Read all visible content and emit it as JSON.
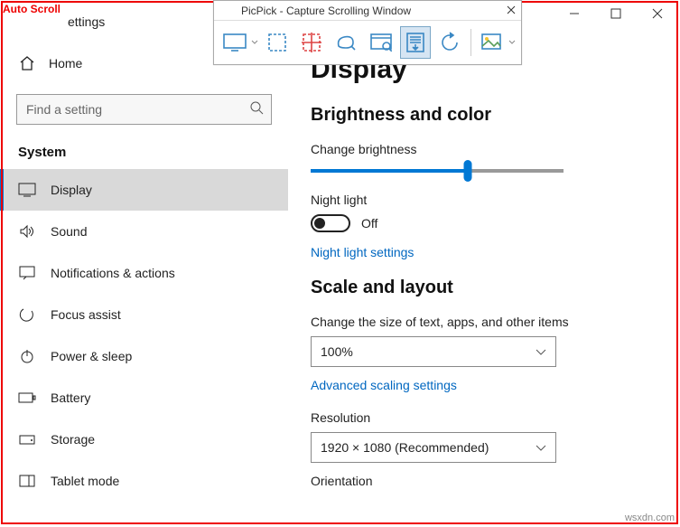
{
  "overlay": {
    "auto_scroll": "Auto Scroll",
    "watermark": "wsxdn.com"
  },
  "window": {
    "title_fragment": "ettings"
  },
  "picpick": {
    "title": "PicPick - Capture Scrolling Window"
  },
  "sidebar": {
    "home": "Home",
    "search_placeholder": "Find a setting",
    "section": "System",
    "items": [
      {
        "label": "Display"
      },
      {
        "label": "Sound"
      },
      {
        "label": "Notifications & actions"
      },
      {
        "label": "Focus assist"
      },
      {
        "label": "Power & sleep"
      },
      {
        "label": "Battery"
      },
      {
        "label": "Storage"
      },
      {
        "label": "Tablet mode"
      }
    ]
  },
  "content": {
    "h1": "Display",
    "h2a": "Brightness and color",
    "brightness_label": "Change brightness",
    "brightness_percent": 62,
    "night_light_label": "Night light",
    "night_light_state": "Off",
    "night_light_link": "Night light settings",
    "h2b": "Scale and layout",
    "scale_label": "Change the size of text, apps, and other items",
    "scale_value": "100%",
    "scale_link": "Advanced scaling settings",
    "resolution_label": "Resolution",
    "resolution_value": "1920 × 1080 (Recommended)",
    "orientation_label": "Orientation"
  }
}
